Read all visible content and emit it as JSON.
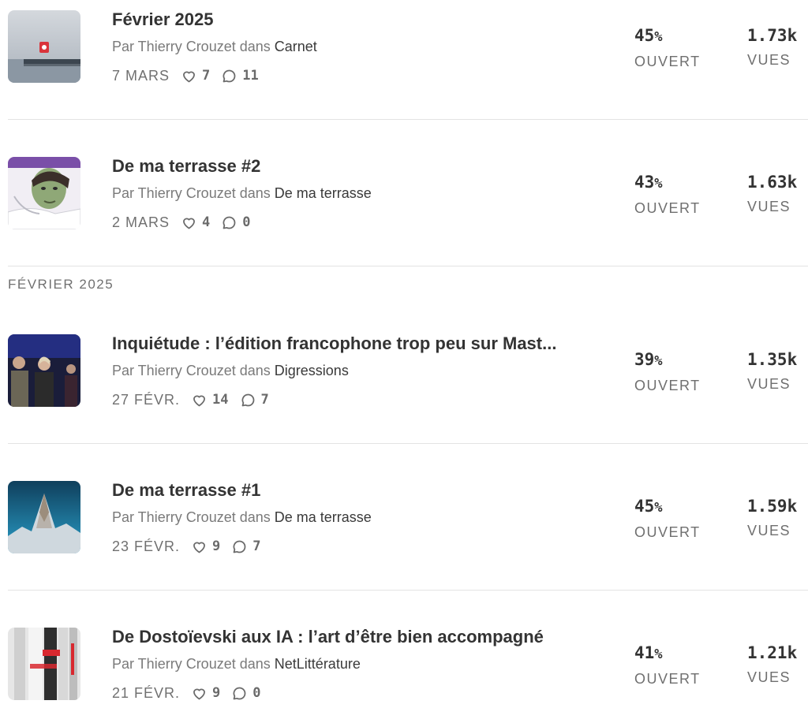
{
  "labels": {
    "by": "Par Thierry Crouzet dans",
    "open": "OUVERT",
    "views": "VUES",
    "percent": "%"
  },
  "section_header": "FÉVRIER 2025",
  "posts": [
    {
      "title": "Février 2025",
      "publication": "Carnet",
      "date": "7 MARS",
      "likes": "7",
      "comments": "11",
      "open_rate": "45",
      "views": "1.73k",
      "thumbnail": "lake-pier-image"
    },
    {
      "title": "De ma terrasse #2",
      "publication": "De ma terrasse",
      "date": "2 MARS",
      "likes": "4",
      "comments": "0",
      "open_rate": "43",
      "views": "1.63k",
      "thumbnail": "portrait-illustration-image"
    },
    {
      "title": "Inquiétude : l’édition francophone trop peu sur Mast...",
      "publication": "Digressions",
      "date": "27 FÉVR.",
      "likes": "14",
      "comments": "7",
      "open_rate": "39",
      "views": "1.35k",
      "thumbnail": "stage-people-image"
    },
    {
      "title": "De ma terrasse #1",
      "publication": "De ma terrasse",
      "date": "23 FÉVR.",
      "likes": "9",
      "comments": "7",
      "open_rate": "45",
      "views": "1.59k",
      "thumbnail": "mountain-peak-image"
    },
    {
      "title": "De Dostoïevski aux IA : l’art d’être bien accompagné",
      "publication": "NetLittérature",
      "date": "21 FÉVR.",
      "likes": "9",
      "comments": "0",
      "open_rate": "41",
      "views": "1.21k",
      "thumbnail": "book-spines-image"
    }
  ],
  "icons": {
    "like": "heart-icon",
    "comment": "comment-bubble-icon"
  },
  "colors": {
    "text": "#333333",
    "muted": "#707070",
    "divider": "#e3e3e3"
  }
}
